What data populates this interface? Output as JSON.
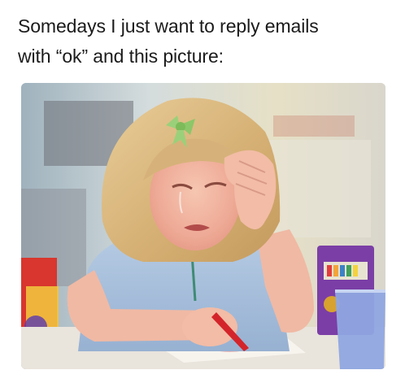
{
  "caption": {
    "line1": "Somedays I just want to reply emails",
    "line2": "with “ok” and this picture:"
  },
  "photo": {
    "subject": "crying-girl-drawing",
    "colors": {
      "background_wall": "#cbd6d8",
      "hair": "#d9b77c",
      "shirt": "#aac2dd",
      "skin": "#f0b9a4",
      "bow": "#9bd07a",
      "crayon": "#d4242b",
      "crayon_box": "#7b3ea6",
      "cup": "#8fa7e0"
    }
  }
}
